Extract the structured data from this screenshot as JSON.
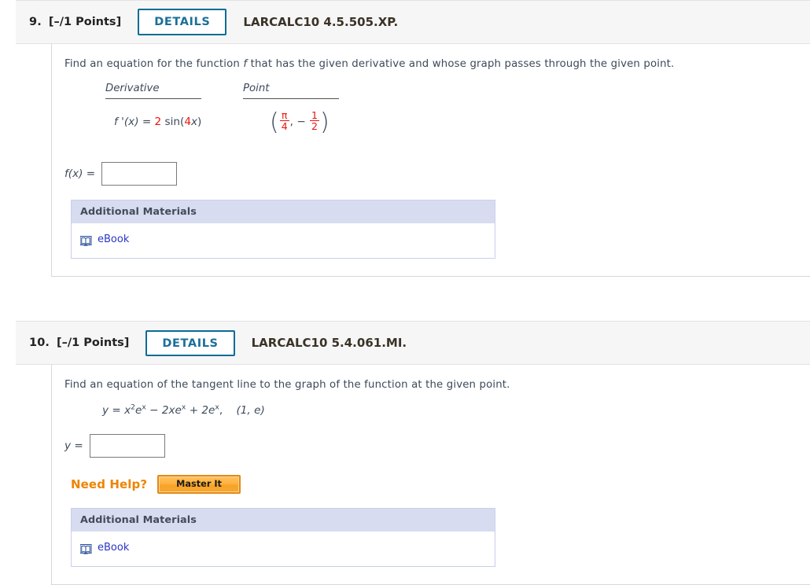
{
  "questions": [
    {
      "number": "9.",
      "points": "[–/1 Points]",
      "details_label": "DETAILS",
      "code": "LARCALC10 4.5.505.XP.",
      "prompt_before": "Find an equation for the function ",
      "prompt_italic": "f",
      "prompt_after": " that has the given derivative and whose graph passes through the given point.",
      "col_headers": {
        "derivative": "Derivative",
        "point": "Point"
      },
      "derivative": {
        "fprime": "f '(x)",
        "equals": "=",
        "coefficient": "2",
        "func": "sin(",
        "inner_coeff": "4",
        "inner_var": "x",
        "close": ")"
      },
      "point": {
        "open_paren": "(",
        "x_num": "π",
        "x_den": "4",
        "comma": ",",
        "minus": "−",
        "y_num": "1",
        "y_den": "2",
        "close_paren": ")"
      },
      "answer_label": "f(x) =",
      "answer_value": "",
      "answer_placeholder": "",
      "has_need_help": false,
      "additional_materials": {
        "title": "Additional Materials",
        "ebook_label": "eBook",
        "ebook_icon": "book-icon"
      }
    },
    {
      "number": "10.",
      "points": "[–/1 Points]",
      "details_label": "DETAILS",
      "code": "LARCALC10 5.4.061.MI.",
      "prompt_full": "Find an equation of the tangent line to the graph of the function at the given point.",
      "equation": {
        "lhs": "y",
        "equals": "=",
        "term1_var": "x",
        "term1_exp": "2",
        "term1_e": "e",
        "term1_e_exp": "x",
        "op1": "−",
        "term2": "2xe",
        "term2_exp": "x",
        "op2": "+",
        "term3": "2e",
        "term3_exp": "x",
        "comma": ",",
        "point": "(1, e)"
      },
      "answer_label": "y =",
      "answer_value": "",
      "answer_placeholder": "",
      "has_need_help": true,
      "need_help": {
        "label": "Need Help?",
        "master_it_label": "Master It"
      },
      "additional_materials": {
        "title": "Additional Materials",
        "ebook_label": "eBook",
        "ebook_icon": "book-icon"
      }
    }
  ],
  "colors": {
    "accent_blue": "#0a6c96",
    "link_blue": "#2b36c4",
    "red_value": "#e8140c",
    "orange": "#ee8400",
    "panel_header": "#d7dcf0",
    "header_bg": "#f6f6f6"
  }
}
